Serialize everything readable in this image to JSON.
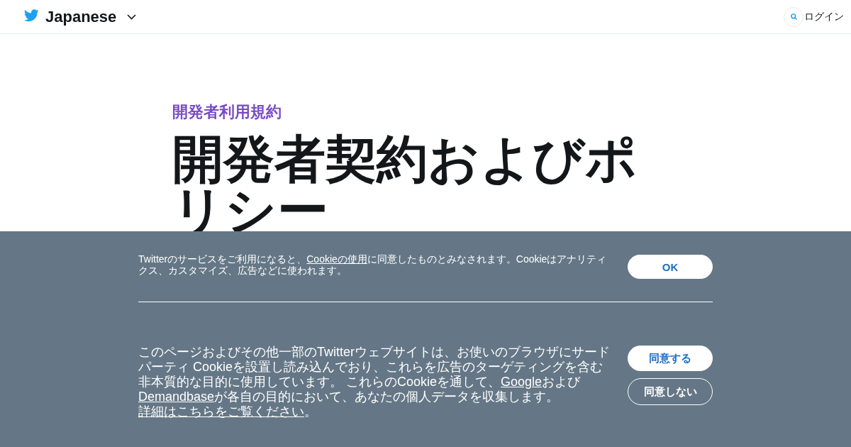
{
  "header": {
    "language": "Japanese",
    "login": "ログイン"
  },
  "page": {
    "eyebrow": "開発者利用規約",
    "title": "開発者契約およびポリシー"
  },
  "cookie_banner": {
    "sections": [
      {
        "segments": [
          {
            "kind": "text",
            "text": "Twitterのサービスをご利用になると、"
          },
          {
            "kind": "link",
            "text": "Cookieの使用"
          },
          {
            "kind": "text",
            "text": "に同意したものとみなされます。Cookieはアナリティクス、カスタマイズ、広告などに使われます。"
          }
        ],
        "buttons": [
          {
            "label": "OK",
            "kind": "primary"
          }
        ]
      },
      {
        "segments": [
          {
            "kind": "text",
            "text": "このページおよびその他一部のTwitterウェブサイトは、お使いのブラウザにサードパーティ Cookieを設置し読み込んでおり、これらを広告のターゲティングを含む非本質的な目的に使用しています。 これらのCookieを通して、"
          },
          {
            "kind": "link",
            "text": "Google"
          },
          {
            "kind": "text",
            "text": "および"
          },
          {
            "kind": "link",
            "text": "Demandbase"
          },
          {
            "kind": "text",
            "text": "が各自の目的において、あなたの個人データを収集します。 "
          },
          {
            "kind": "link",
            "text": "詳細はこちらをご覧ください"
          },
          {
            "kind": "text",
            "text": "。"
          }
        ],
        "buttons": [
          {
            "label": "同意する",
            "kind": "primary"
          },
          {
            "label": "同意しない",
            "kind": "outline"
          }
        ]
      }
    ]
  }
}
